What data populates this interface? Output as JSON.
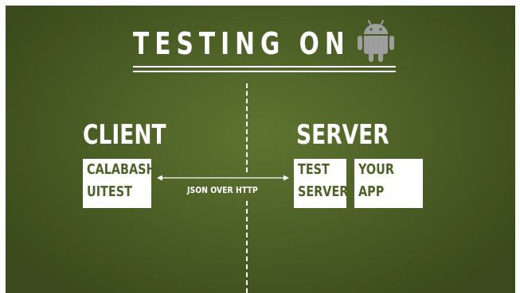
{
  "title": {
    "text": "TESTING ON",
    "icon": "android-robot-icon"
  },
  "client": {
    "heading": "CLIENT",
    "box": {
      "line1": "CALABASH",
      "line2": "UITEST"
    }
  },
  "server": {
    "heading": "SERVER",
    "boxes": [
      {
        "line1": "TEST",
        "line2": "SERVER"
      },
      {
        "line1": "YOUR",
        "line2": "APP"
      }
    ]
  },
  "connection": {
    "label": "JSON OVER HTTP",
    "type": "bidirectional-arrow"
  },
  "colors": {
    "background": "#4e6227",
    "foreground": "#ffffff",
    "box_text": "#4e6227",
    "android_icon": "#9e9e9e"
  }
}
